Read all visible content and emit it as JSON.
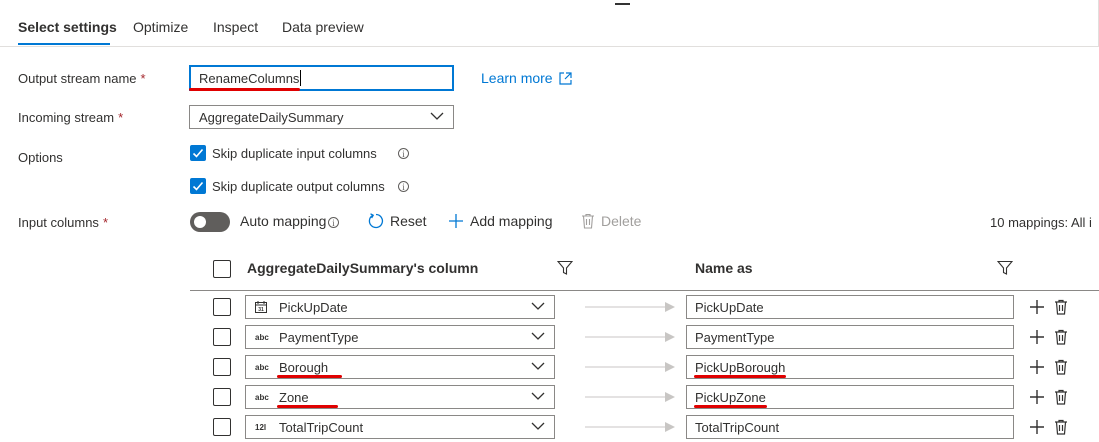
{
  "tabs": [
    {
      "label": "Select settings",
      "active": true
    },
    {
      "label": "Optimize",
      "active": false
    },
    {
      "label": "Inspect",
      "active": false
    },
    {
      "label": "Data preview",
      "active": false
    }
  ],
  "form": {
    "output_stream": {
      "label": "Output stream name",
      "required": "*",
      "value": "RenameColumns"
    },
    "learn_more": "Learn more",
    "incoming_stream": {
      "label": "Incoming stream",
      "required": "*",
      "value": "AggregateDailySummary"
    },
    "options": {
      "label": "Options",
      "items": [
        {
          "label": "Skip duplicate input columns",
          "checked": true
        },
        {
          "label": "Skip duplicate output columns",
          "checked": true
        }
      ]
    },
    "input_columns": {
      "label": "Input columns",
      "required": "*"
    }
  },
  "toolbar": {
    "auto_mapping": "Auto mapping",
    "auto_mapping_on": false,
    "reset": "Reset",
    "add_mapping": "Add mapping",
    "delete": "Delete",
    "mappings_summary": "10 mappings: All i"
  },
  "table": {
    "source_header": "AggregateDailySummary's column",
    "target_header": "Name as",
    "rows": [
      {
        "type": "date",
        "type_text": "",
        "source": "PickUpDate",
        "target": "PickUpDate"
      },
      {
        "type": "string",
        "type_text": "abc",
        "source": "PaymentType",
        "target": "PaymentType"
      },
      {
        "type": "string",
        "type_text": "abc",
        "source": "Borough",
        "target": "PickUpBorough"
      },
      {
        "type": "string",
        "type_text": "abc",
        "source": "Zone",
        "target": "PickUpZone"
      },
      {
        "type": "integer",
        "type_text": "12l",
        "source": "TotalTripCount",
        "target": "TotalTripCount"
      }
    ]
  },
  "colors": {
    "accent": "#0078d4",
    "annotation": "#e00000",
    "required": "#a4262c"
  }
}
